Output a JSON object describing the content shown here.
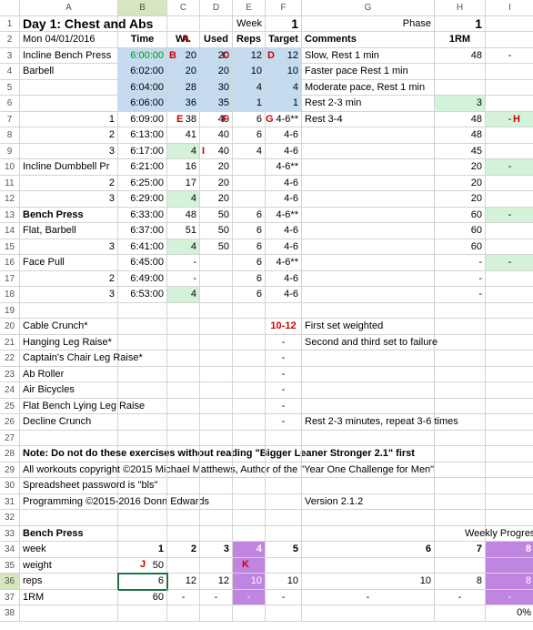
{
  "columns": [
    "",
    "A",
    "B",
    "C",
    "D",
    "E",
    "F",
    "G",
    "H",
    "I"
  ],
  "title": "Day 1: Chest and Abs",
  "dateLabel": "Mon 04/01/2016",
  "headers": {
    "time": "Time",
    "wt": "Wt.",
    "used": "Used",
    "reps": "Reps",
    "target": "Target",
    "comments": "Comments",
    "rm": "1RM",
    "week": "Week",
    "weekVal": "1",
    "phase": "Phase",
    "phaseVal": "1"
  },
  "marks": {
    "A": "A",
    "B": "B",
    "C": "C",
    "D": "D",
    "E": "E",
    "F": "F",
    "G": "G",
    "H": "H",
    "I": "I",
    "J": "J",
    "K": "K"
  },
  "rows": [
    {
      "n": "3",
      "a": "Incline Bench Press",
      "b": "6:00:00",
      "c": "20",
      "d": "20",
      "e": "12",
      "f": "12",
      "g": "Slow, Rest 1 min",
      "h": "48",
      "i": "-",
      "blue": 1,
      "gt": 1
    },
    {
      "n": "4",
      "a": "Barbell",
      "b": "6:02:00",
      "c": "20",
      "d": "20",
      "e": "10",
      "f": "10",
      "g": "Faster pace Rest 1 min",
      "h": "",
      "i": "",
      "blue": 1
    },
    {
      "n": "5",
      "a": "",
      "b": "6:04:00",
      "c": "28",
      "d": "30",
      "e": "4",
      "f": "4",
      "g": "Moderate pace, Rest 1 min",
      "h": "",
      "i": "",
      "blue": 1
    },
    {
      "n": "6",
      "a": "",
      "b": "6:06:00",
      "c": "36",
      "d": "35",
      "e": "1",
      "f": "1",
      "g": "Rest 2-3 min",
      "h": "3",
      "i": "",
      "blue": 1,
      "hmint": 1
    },
    {
      "n": "7",
      "a": "1",
      "ar": 1,
      "b": "6:09:00",
      "c": "38",
      "d": "40",
      "e": "6",
      "f": "4-6**",
      "g": "Rest 3-4",
      "h": "48",
      "i": "-",
      "imint": 1
    },
    {
      "n": "8",
      "a": "2",
      "ar": 1,
      "b": "6:13:00",
      "c": "41",
      "d": "40",
      "e": "6",
      "f": "4-6",
      "g": "",
      "h": "48",
      "i": ""
    },
    {
      "n": "9",
      "a": "3",
      "ar": 1,
      "b": "6:17:00",
      "c": "4",
      "d": "40",
      "e": "4",
      "f": "4-6",
      "g": "",
      "h": "45",
      "i": "",
      "cmint": 1
    },
    {
      "n": "10",
      "a": "Incline Dumbbell Pr",
      "b": "6:21:00",
      "c": "16",
      "d": "20",
      "e": "",
      "f": "4-6**",
      "g": "",
      "h": "20",
      "i": "-",
      "imint": 1
    },
    {
      "n": "11",
      "a": "2",
      "ar": 1,
      "b": "6:25:00",
      "c": "17",
      "d": "20",
      "e": "",
      "f": "4-6",
      "g": "",
      "h": "20",
      "i": ""
    },
    {
      "n": "12",
      "a": "3",
      "ar": 1,
      "b": "6:29:00",
      "c": "4",
      "d": "20",
      "e": "",
      "f": "4-6",
      "g": "",
      "h": "20",
      "i": "",
      "cmint": 1
    },
    {
      "n": "13",
      "a": "Bench Press",
      "ab": 1,
      "b": "6:33:00",
      "c": "48",
      "d": "50",
      "e": "6",
      "f": "4-6**",
      "g": "",
      "h": "60",
      "i": "-",
      "imint": 1
    },
    {
      "n": "14",
      "a": "Flat, Barbell",
      "b": "6:37:00",
      "c": "51",
      "d": "50",
      "e": "6",
      "f": "4-6",
      "g": "",
      "h": "60",
      "i": ""
    },
    {
      "n": "15",
      "a": "3",
      "ar": 1,
      "b": "6:41:00",
      "c": "4",
      "d": "50",
      "e": "6",
      "f": "4-6",
      "g": "",
      "h": "60",
      "i": "",
      "cmint": 1
    },
    {
      "n": "16",
      "a": "Face Pull",
      "b": "6:45:00",
      "c": "-",
      "d": "",
      "e": "6",
      "f": "4-6**",
      "g": "",
      "h": "-",
      "i": "-",
      "imint": 1
    },
    {
      "n": "17",
      "a": "2",
      "ar": 1,
      "b": "6:49:00",
      "c": "-",
      "d": "",
      "e": "6",
      "f": "4-6",
      "g": "",
      "h": "-",
      "i": ""
    },
    {
      "n": "18",
      "a": "3",
      "ar": 1,
      "b": "6:53:00",
      "c": "4",
      "d": "",
      "e": "6",
      "f": "4-6",
      "g": "",
      "h": "-",
      "i": "",
      "cmint": 1
    }
  ],
  "bottomRows": [
    {
      "n": "20",
      "a": "Cable Crunch*",
      "f": "10-12",
      "fred": 1,
      "g": "First set weighted"
    },
    {
      "n": "21",
      "a": "Hanging Leg Raise*",
      "f": "-",
      "g": "Second and third set to failure"
    },
    {
      "n": "22",
      "a": "Captain's Chair Leg Raise*",
      "f": "-",
      "g": ""
    },
    {
      "n": "23",
      "a": "Ab Roller",
      "f": "-",
      "g": ""
    },
    {
      "n": "24",
      "a": "Air Bicycles",
      "f": "-",
      "g": ""
    },
    {
      "n": "25",
      "a": "Flat Bench Lying Leg Raise",
      "f": "-",
      "g": ""
    },
    {
      "n": "26",
      "a": "Decline Crunch",
      "f": "-",
      "g": "Rest 2-3 minutes, repeat 3-6 times"
    }
  ],
  "notes": {
    "r28": "Note: Do not do these exercises without reading \"Bigger Leaner Stronger 2.1\" first",
    "r29": "All workouts copyright ©2015 Michael Matthews, Author of the \"Year One Challenge for Men\"",
    "r30": "Spreadsheet password is \"bls\"",
    "r31": "Programming ©2015-2016 Donn Edwards",
    "r31v": "Version 2.1.2"
  },
  "bench": {
    "title": "Bench Press",
    "weekly": "Weekly Progress",
    "rows": {
      "week": {
        "label": "week",
        "v": [
          "1",
          "2",
          "3",
          "4",
          "5",
          "",
          "6",
          "7",
          "8"
        ]
      },
      "weight": {
        "label": "weight",
        "v": [
          "50",
          "",
          "",
          "",
          "",
          "",
          "",
          "",
          ""
        ]
      },
      "reps": {
        "label": "reps",
        "v": [
          "6",
          "12",
          "12",
          "10",
          "10",
          "",
          "10",
          "8",
          "8"
        ]
      },
      "rm": {
        "label": "1RM",
        "v": [
          "60",
          "-",
          "-",
          "-",
          "-",
          "",
          "-",
          "-",
          "-"
        ]
      }
    },
    "pct": "0%"
  }
}
